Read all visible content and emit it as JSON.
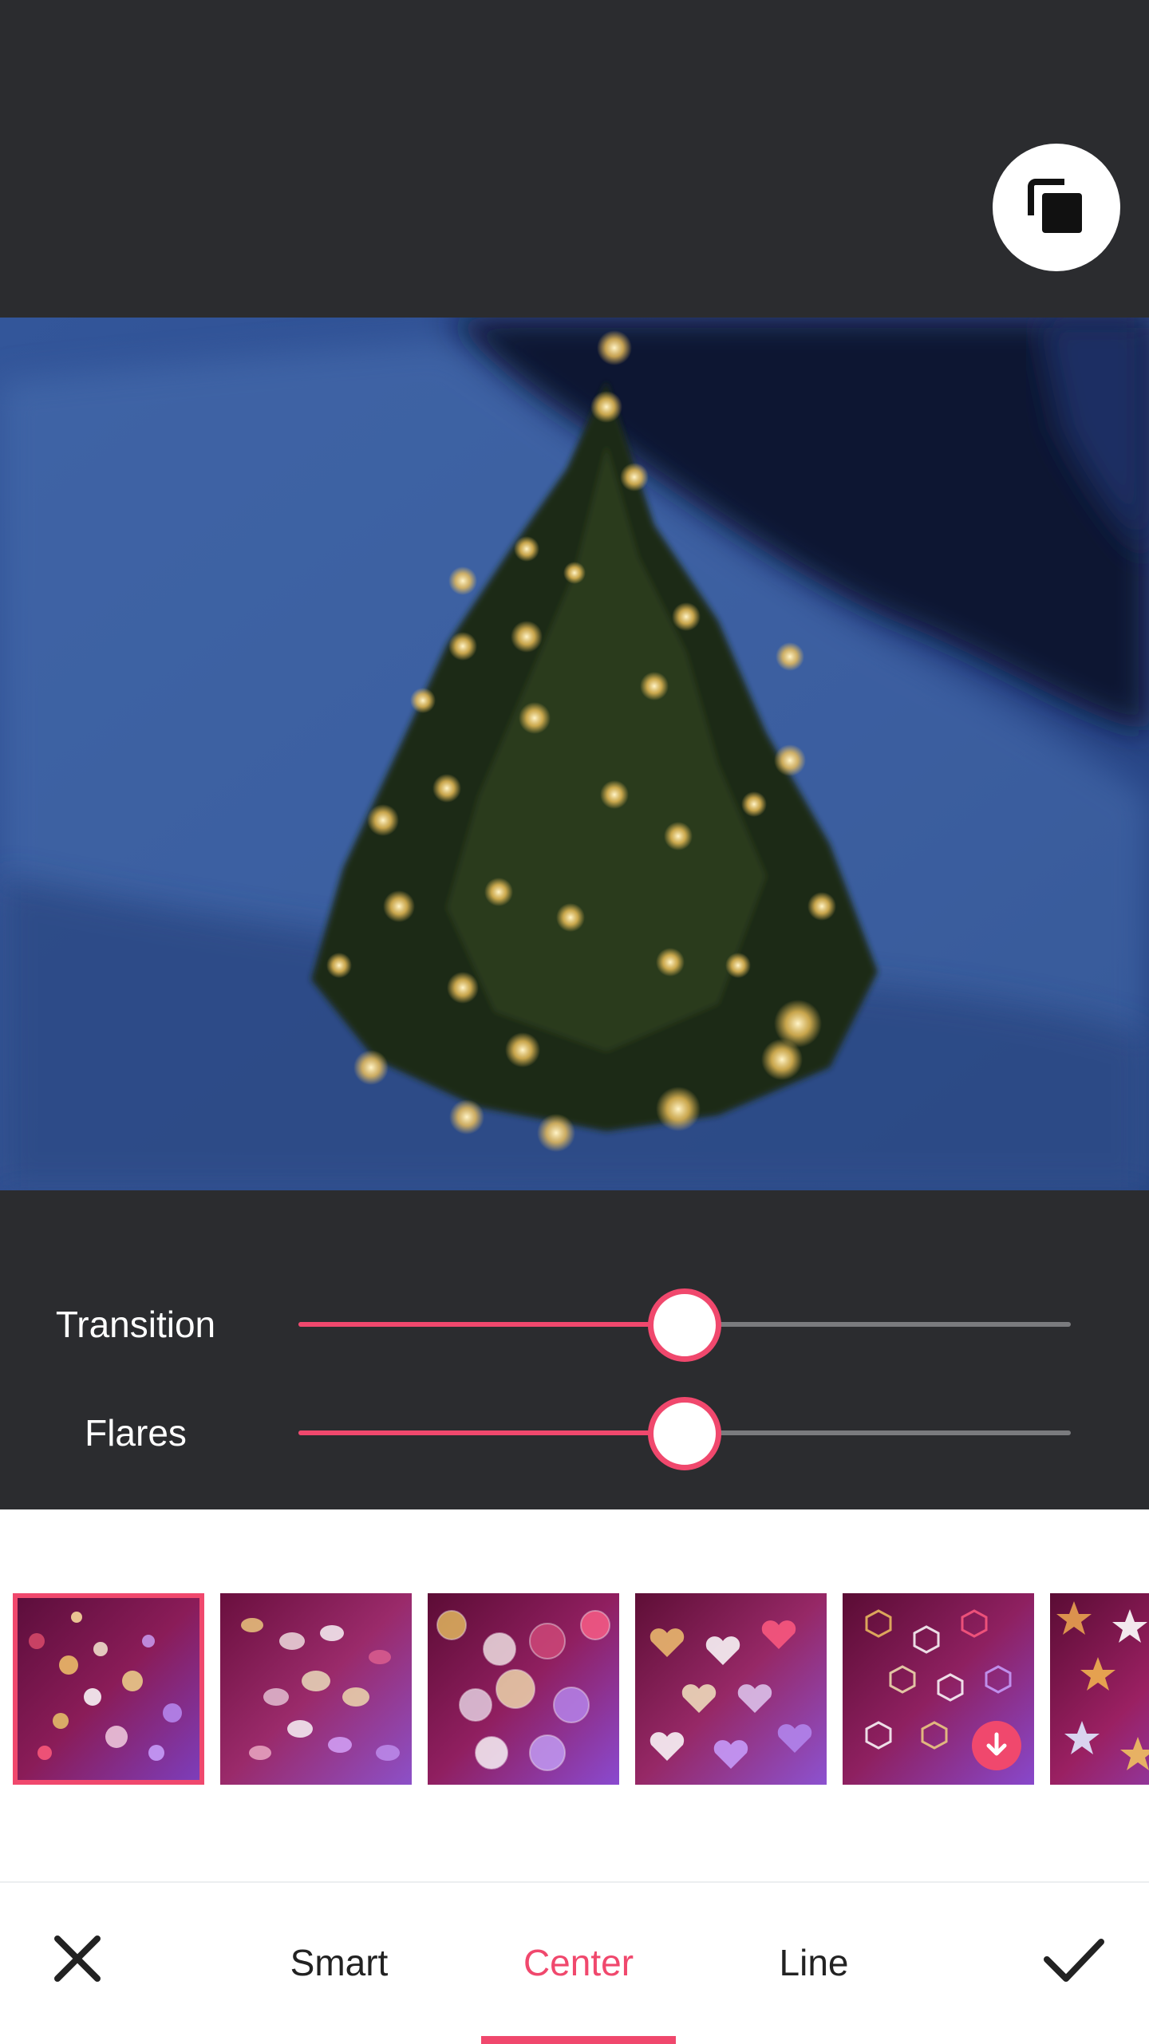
{
  "header": {
    "compare_icon": "compare-icon"
  },
  "controls": {
    "sliders": [
      {
        "label": "Transition",
        "value": 0.5
      },
      {
        "label": "Flares",
        "value": 0.5
      }
    ]
  },
  "thumbnails": {
    "items": [
      {
        "name": "bokeh-dots",
        "selected": true,
        "download": false
      },
      {
        "name": "bokeh-swirl",
        "selected": false,
        "download": false
      },
      {
        "name": "bokeh-circles",
        "selected": false,
        "download": false
      },
      {
        "name": "bokeh-hearts",
        "selected": false,
        "download": false
      },
      {
        "name": "bokeh-hexagons",
        "selected": false,
        "download": true
      },
      {
        "name": "bokeh-stars",
        "selected": false,
        "download": false
      }
    ]
  },
  "bottom_bar": {
    "tabs": [
      {
        "label": "Smart",
        "active": false
      },
      {
        "label": "Center",
        "active": true
      },
      {
        "label": "Line",
        "active": false
      }
    ],
    "cancel_icon": "close-icon",
    "confirm_icon": "check-icon"
  },
  "colors": {
    "accent": "#f0486d",
    "panel": "#2b2c2f",
    "inactive_track": "#7a7b7e"
  }
}
